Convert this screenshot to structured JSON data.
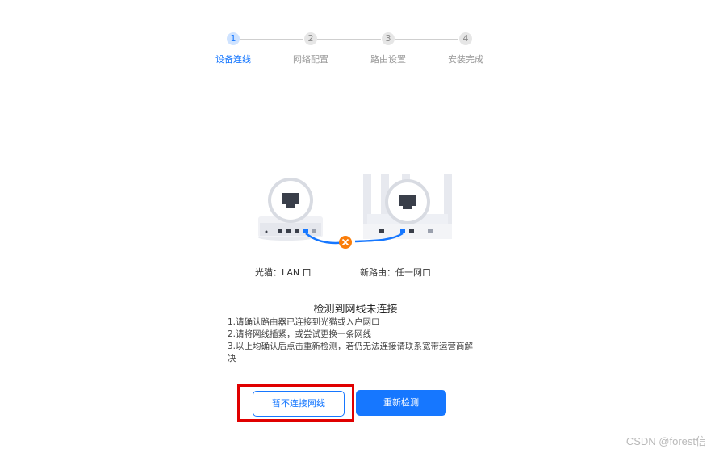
{
  "wizard": {
    "steps": [
      {
        "number": "1",
        "label": "设备连线",
        "state": "active"
      },
      {
        "number": "2",
        "label": "网络配置",
        "state": "pending"
      },
      {
        "number": "3",
        "label": "路由设置",
        "state": "pending"
      },
      {
        "number": "4",
        "label": "安装完成",
        "state": "pending"
      }
    ]
  },
  "illustration": {
    "left_device_label": "光猫：LAN 口",
    "right_device_label": "新路由：任一网口",
    "status_icon": "disconnected-x-icon",
    "cable_color": "#1677ff",
    "error_color": "#fa7d09"
  },
  "error": {
    "title": "检测到网线未连接",
    "lines": [
      "1.请确认路由器已连接到光猫或入户网口",
      "2.请将网线插紧，或尝试更换一条网线",
      "3.以上均确认后点击重新检测，若仍无法连接请联系宽带运营商解决"
    ]
  },
  "buttons": {
    "skip_label": "暂不连接网线",
    "retry_label": "重新检测"
  },
  "watermark": "CSDN @forest信",
  "colors": {
    "accent": "#1677ff",
    "highlight_border": "#e00000"
  }
}
